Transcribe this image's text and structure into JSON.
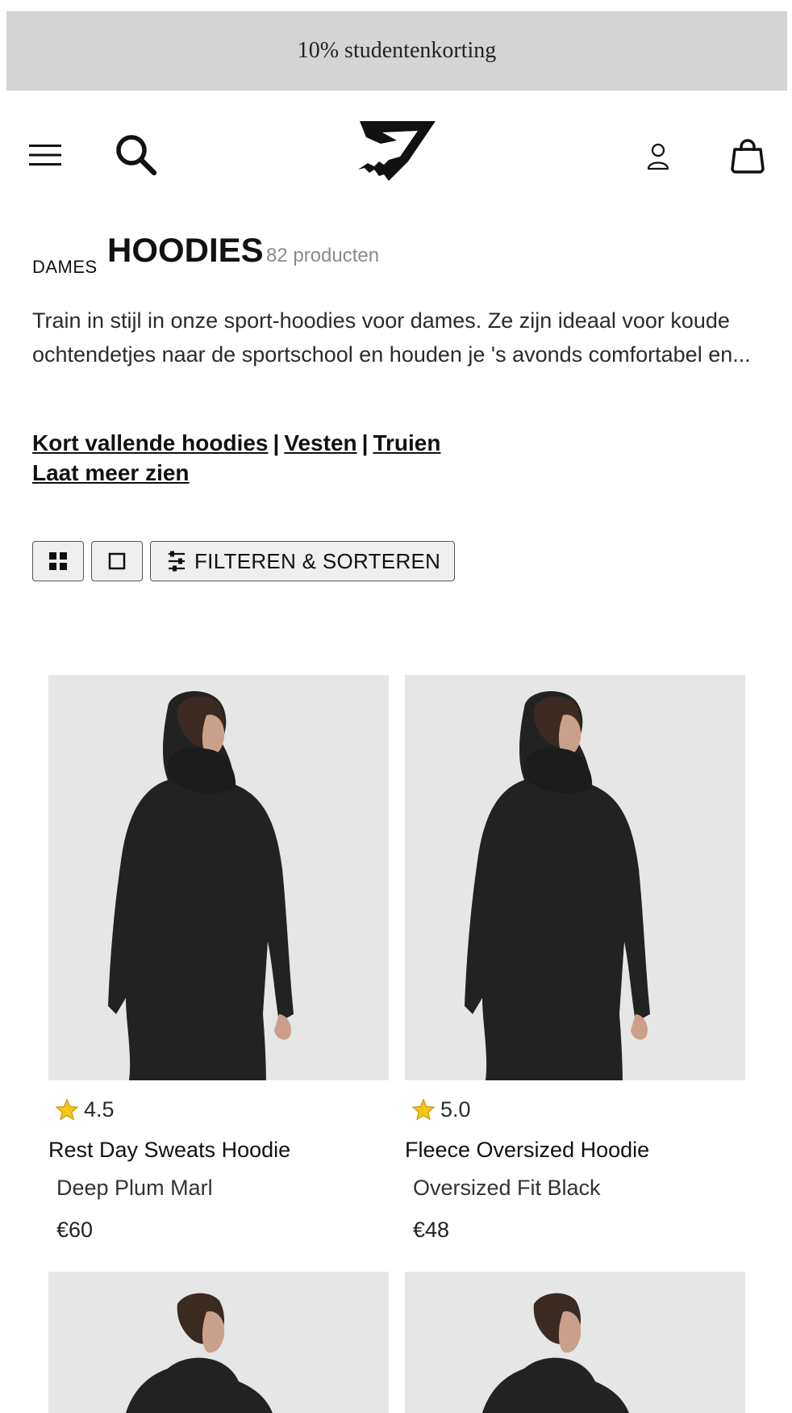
{
  "promo": {
    "text": "10% studentenkorting"
  },
  "header": {
    "menu_icon": "hamburger-icon",
    "search_icon": "search-icon",
    "logo": "gymshark-logo",
    "account_icon": "user-icon",
    "bag_icon": "shopping-bag-icon"
  },
  "category": {
    "breadcrumb": "DAMES",
    "title": "HOODIES",
    "count": "82 producten",
    "description": "Train in stijl in onze sport-hoodies voor dames. Ze zijn ideaal voor koude ochtendetjes naar de sportschool en houden je 's avonds comfortabel en...",
    "links": [
      "Kort vallende hoodies",
      "Vesten",
      "Truien"
    ],
    "separator": "|",
    "more_link": "Laat meer zien"
  },
  "toolbar": {
    "grid_icon": "grid-view-icon",
    "single_icon": "single-view-icon",
    "filter_icon": "sliders-icon",
    "filter_label": "FILTEREN & SORTEREN"
  },
  "products": [
    {
      "rating": "4.5",
      "name": "Rest Day Sweats Hoodie",
      "color": "Deep Plum Marl",
      "price": "€60"
    },
    {
      "rating": "5.0",
      "name": "Fleece Oversized Hoodie",
      "color": "Oversized Fit Black",
      "price": "€48"
    },
    {
      "rating": "",
      "name": "",
      "color": "",
      "price": ""
    },
    {
      "rating": "",
      "name": "",
      "color": "",
      "price": ""
    }
  ],
  "colors": {
    "promo_bg": "#d4d4d4",
    "image_bg": "#e6e6e6",
    "star": "#f5c518"
  }
}
